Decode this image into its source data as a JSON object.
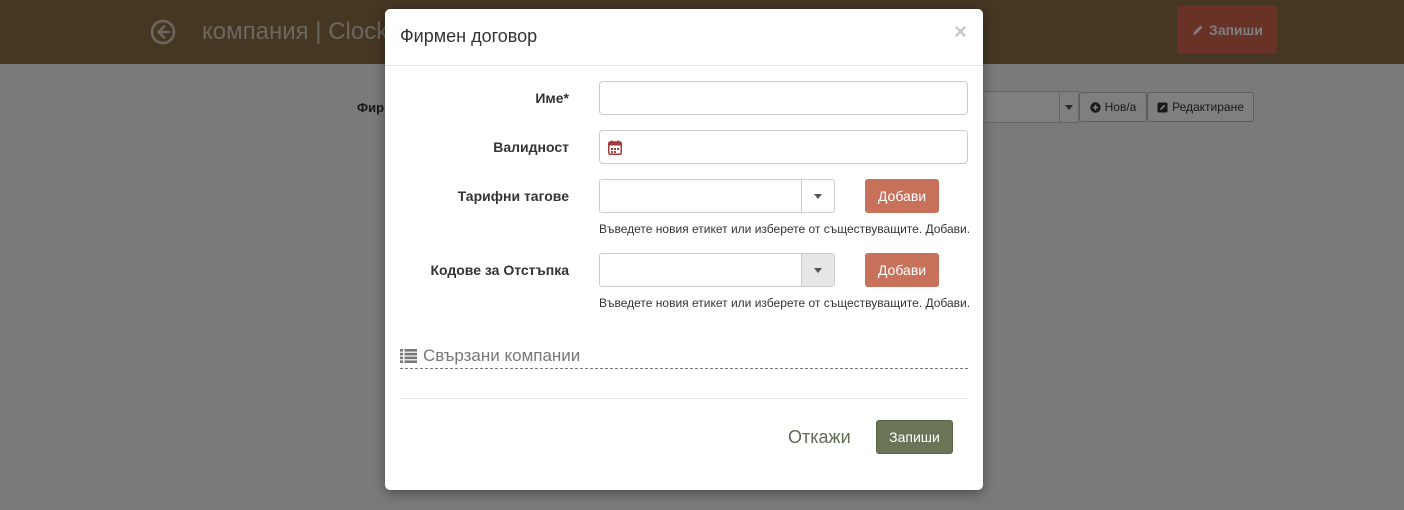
{
  "page": {
    "title": "компания | Clock",
    "save_button": "Запиши",
    "contract_label": "Фир",
    "new_button": "Нов/а",
    "edit_button": "Редактиране"
  },
  "modal": {
    "title": "Фирмен договор",
    "close": "×",
    "fields": {
      "name_label": "Име*",
      "name_value": "",
      "validity_label": "Валидност",
      "validity_value": "",
      "tariff_tags_label": "Тарифни тагове",
      "tariff_tags_value": "",
      "discount_codes_label": "Кодове за Отстъпка",
      "discount_codes_value": "",
      "add_button": "Добави",
      "help_text": "Въведете новия етикет или изберете от съществуващите. Добави."
    },
    "linked_companies": "Свързани компании",
    "cancel": "Откажи",
    "save": "Запиши"
  },
  "colors": {
    "topbar": "#8c6e45",
    "top_save": "#d2654e",
    "add_button": "#c8715a",
    "save_button": "#6a7558",
    "cancel_link": "#5f6b52"
  },
  "icons": [
    "back-circle-icon",
    "pencil-icon",
    "plus-circle-icon",
    "edit-icon",
    "calendar-icon",
    "chevron-down-icon",
    "list-icon",
    "close-icon"
  ]
}
